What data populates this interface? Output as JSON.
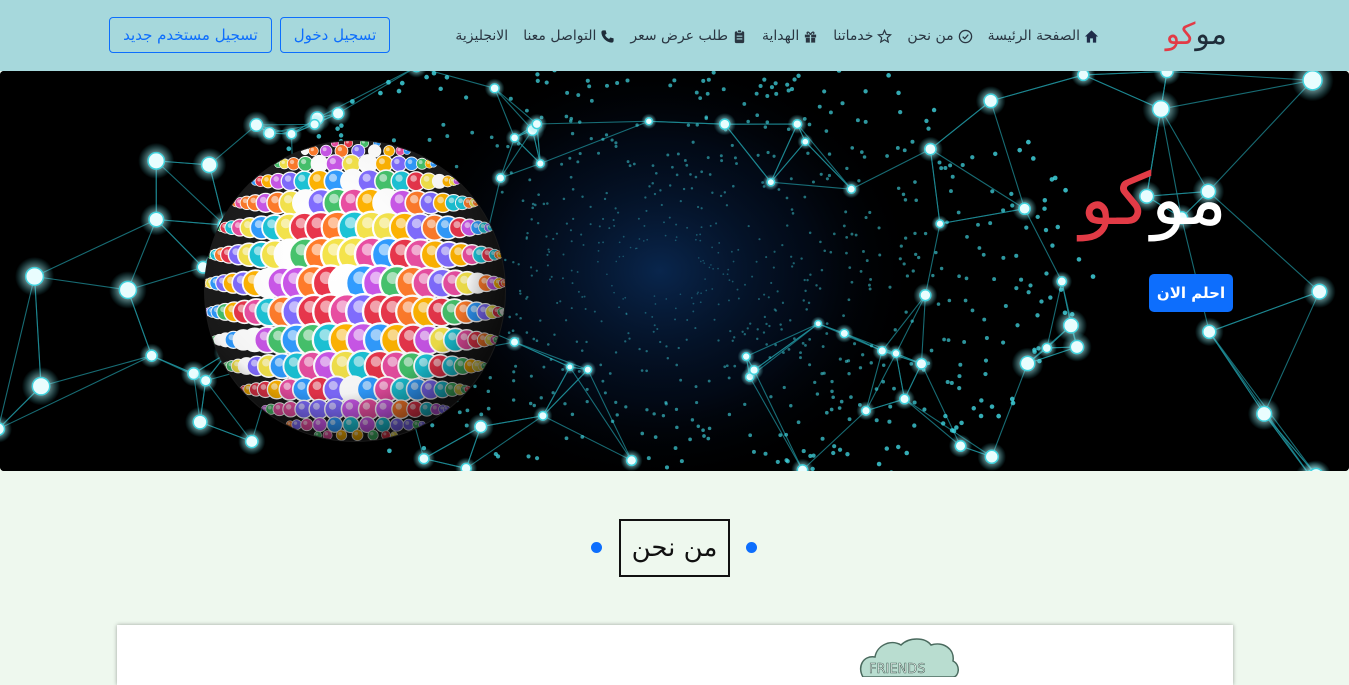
{
  "brand": {
    "part1": "مو",
    "part2": "كو"
  },
  "nav": {
    "items": [
      {
        "label": "الصفحة الرئيسة",
        "icon": "home-icon"
      },
      {
        "label": "من نحن",
        "icon": "check-circle-icon"
      },
      {
        "label": "خدماتنا",
        "icon": "star-icon"
      },
      {
        "label": "الهداية",
        "icon": "gift-icon"
      },
      {
        "label": "طلب عرض سعر",
        "icon": "clipboard-icon"
      },
      {
        "label": "التواصل معنا",
        "icon": "phone-icon"
      },
      {
        "label": "الانجليزية",
        "icon": ""
      }
    ],
    "login_label": "تسجيل دخول",
    "register_label": "تسجيل مستخدم جديد"
  },
  "hero": {
    "title_part1": "مو",
    "title_part2": "كو",
    "cta_label": "احلم الان",
    "globe_image": "social-media-apps-globe"
  },
  "about": {
    "heading": "من نحن"
  },
  "card": {
    "partial_image_text": "FRIENDS"
  },
  "colors": {
    "navbar_bg": "#a6d8dc",
    "accent_blue": "#0d6efd",
    "brand_red": "#e23b46",
    "page_bg": "#eef8ee",
    "network_cyan": "#3fd1dc"
  }
}
